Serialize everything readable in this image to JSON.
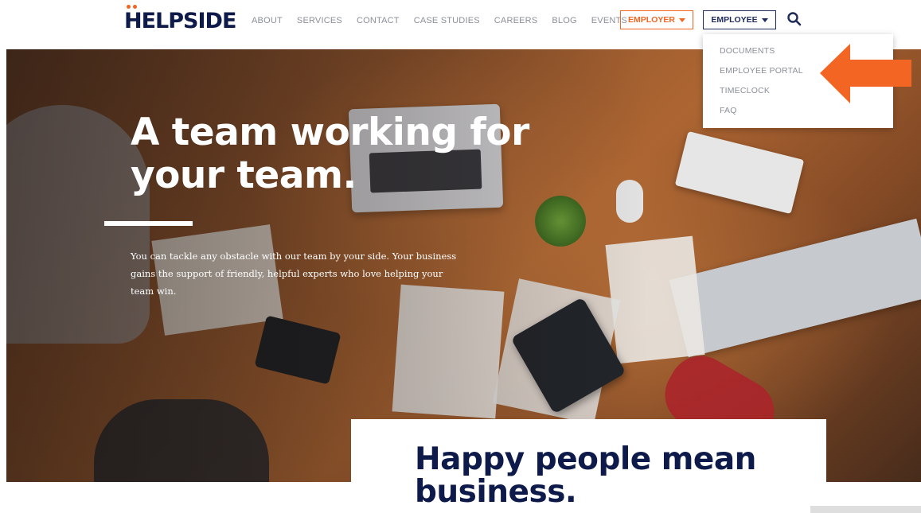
{
  "header": {
    "logo_text": "HELPSIDE",
    "nav": [
      {
        "label": "ABOUT"
      },
      {
        "label": "SERVICES"
      },
      {
        "label": "CONTACT"
      },
      {
        "label": "CASE STUDIES"
      },
      {
        "label": "CAREERS"
      },
      {
        "label": "BLOG"
      },
      {
        "label": "EVENTS"
      }
    ],
    "employer_button": "EMPLOYER",
    "employee_button": "EMPLOYEE",
    "search_icon": "search-icon"
  },
  "employee_dropdown": {
    "items": [
      {
        "label": "DOCUMENTS"
      },
      {
        "label": "EMPLOYEE PORTAL"
      },
      {
        "label": "TIMECLOCK"
      },
      {
        "label": "FAQ"
      }
    ]
  },
  "hero": {
    "headline": "A team working for your team.",
    "body": "You can tackle any obstacle with our team by your side. Your business gains the support of friendly, helpful experts who love helping your team win."
  },
  "card": {
    "title": "Happy people mean business."
  },
  "annotation": {
    "arrow_icon": "arrow-left-icon",
    "arrow_color": "#f26522"
  },
  "colors": {
    "brand_navy": "#0d1a4a",
    "brand_orange": "#f26522",
    "nav_grey": "#8a8f99"
  }
}
